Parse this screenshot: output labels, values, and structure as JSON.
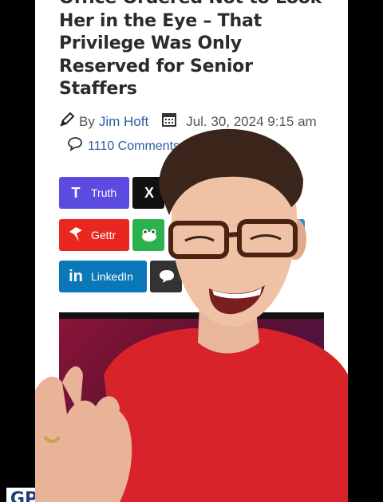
{
  "article": {
    "headline_lines": [
      "Office Ordered Not to Look",
      "Her in the Eye – That",
      "Privilege Was Only",
      "Reserved for Senior",
      "Staffers"
    ],
    "by_label": "By",
    "author": "Jim Hoft",
    "date": "Jul. 30, 2024 9:15 am",
    "comments": "1110 Comments"
  },
  "share_buttons": {
    "truth": "Truth",
    "x": "X",
    "gettr": "Gettr",
    "linkedin": "LinkedIn"
  },
  "logo_text": "GP",
  "icons": [
    "pencil-icon",
    "calendar-icon",
    "comment-icon",
    "truth-icon",
    "x-icon",
    "gettr-icon",
    "frog-icon",
    "linkedin-icon",
    "sms-icon"
  ],
  "colors": {
    "truth": "#5b4be0",
    "x": "#111111",
    "gettr": "#e8271f",
    "frog": "#2bb24c",
    "linkedin": "#0a78b8",
    "sms": "#333333",
    "author_link": "#2c5aa0",
    "shirt": "#d8232a"
  }
}
